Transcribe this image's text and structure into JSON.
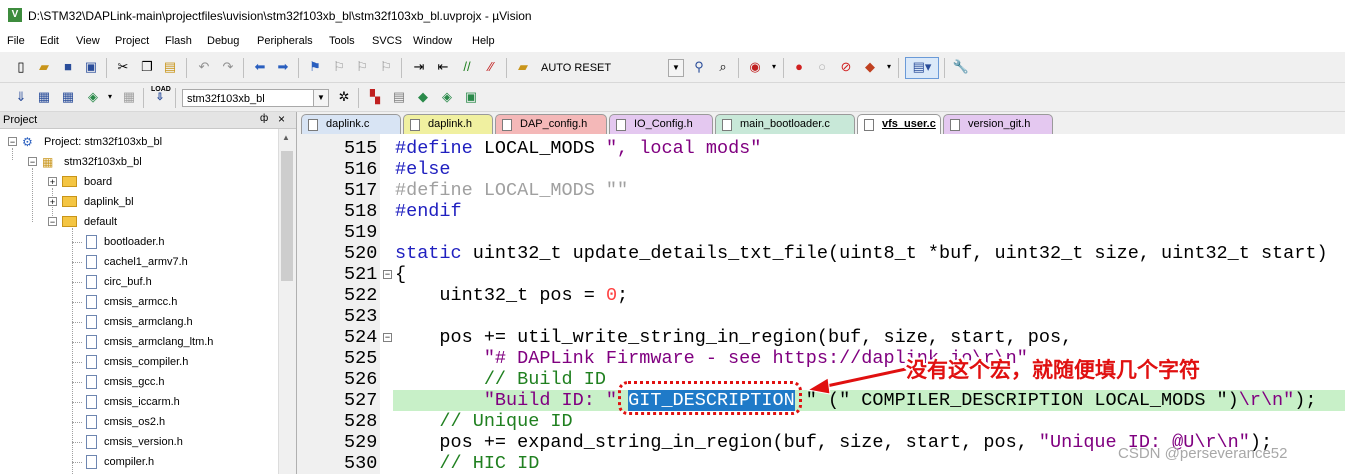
{
  "window": {
    "app_icon_letter": "V",
    "title": "D:\\STM32\\DAPLink-main\\projectfiles\\uvision\\stm32f103xb_bl\\stm32f103xb_bl.uvprojx - µVision"
  },
  "menu": [
    "File",
    "Edit",
    "View",
    "Project",
    "Flash",
    "Debug",
    "Peripherals",
    "Tools",
    "SVCS",
    "Window",
    "Help"
  ],
  "toolbar": {
    "reset_combo": "AUTO RESET",
    "target_combo": "stm32f103xb_bl",
    "load_label": "LOAD"
  },
  "project_panel": {
    "title": "Project",
    "pin": "ф",
    "close": "×",
    "tree": [
      {
        "label": "Project: stm32f103xb_bl",
        "kind": "project"
      },
      {
        "label": "stm32f103xb_bl",
        "kind": "target"
      },
      {
        "label": "board",
        "kind": "folder"
      },
      {
        "label": "daplink_bl",
        "kind": "folder"
      },
      {
        "label": "default",
        "kind": "folder"
      },
      {
        "label": "bootloader.h",
        "kind": "file"
      },
      {
        "label": "cachel1_armv7.h",
        "kind": "file"
      },
      {
        "label": "circ_buf.h",
        "kind": "file"
      },
      {
        "label": "cmsis_armcc.h",
        "kind": "file"
      },
      {
        "label": "cmsis_armclang.h",
        "kind": "file"
      },
      {
        "label": "cmsis_armclang_ltm.h",
        "kind": "file"
      },
      {
        "label": "cmsis_compiler.h",
        "kind": "file"
      },
      {
        "label": "cmsis_gcc.h",
        "kind": "file"
      },
      {
        "label": "cmsis_iccarm.h",
        "kind": "file"
      },
      {
        "label": "cmsis_os2.h",
        "kind": "file"
      },
      {
        "label": "cmsis_version.h",
        "kind": "file"
      },
      {
        "label": "compiler.h",
        "kind": "file"
      }
    ]
  },
  "tabs": [
    {
      "label": "daplink.c",
      "color": "#d8e4f4"
    },
    {
      "label": "daplink.h",
      "color": "#f0f0a0"
    },
    {
      "label": "DAP_config.h",
      "color": "#f4b8b8"
    },
    {
      "label": "IO_Config.h",
      "color": "#e4c8f0"
    },
    {
      "label": "main_bootloader.c",
      "color": "#c8e8d8"
    },
    {
      "label": "vfs_user.c",
      "color": "#ffffff",
      "active": true
    },
    {
      "label": "version_git.h",
      "color": "#e4c8f0"
    }
  ],
  "editor": {
    "lines": [
      {
        "n": "515",
        "parts": [
          [
            "pp",
            "#define"
          ],
          [
            "",
            " LOCAL_MODS "
          ],
          [
            "str",
            "\", local mods\""
          ]
        ]
      },
      {
        "n": "516",
        "parts": [
          [
            "pp",
            "#else"
          ]
        ]
      },
      {
        "n": "517",
        "parts": [
          [
            "ppg",
            "#define LOCAL_MODS \"\""
          ]
        ]
      },
      {
        "n": "518",
        "parts": [
          [
            "pp",
            "#endif"
          ]
        ]
      },
      {
        "n": "519",
        "parts": []
      },
      {
        "n": "520",
        "parts": [
          [
            "kw",
            "static"
          ],
          [
            "",
            " uint32_t update_details_txt_file(uint8_t *buf, uint32_t size, uint32_t start)"
          ]
        ]
      },
      {
        "n": "521",
        "parts": [
          [
            "",
            "{"
          ]
        ],
        "fold": true
      },
      {
        "n": "522",
        "parts": [
          [
            "",
            "    uint32_t pos = "
          ],
          [
            "num",
            "0"
          ],
          [
            "",
            ";"
          ]
        ]
      },
      {
        "n": "523",
        "parts": []
      },
      {
        "n": "524",
        "parts": [
          [
            "",
            "    pos += util_write_string_in_region(buf, size, start, pos,"
          ]
        ],
        "fold": true
      },
      {
        "n": "525",
        "parts": [
          [
            "str",
            "        \"# DAPLink Firmware - see https://daplink.io\\r\\n\""
          ]
        ]
      },
      {
        "n": "526",
        "parts": [
          [
            "cmt",
            "        // Build ID"
          ]
        ]
      },
      {
        "n": "527",
        "parts": [
          [
            "str",
            "        \"Build ID: \" "
          ],
          [
            "sel",
            "GIT_DESCRIPTION"
          ],
          [
            "",
            " \" (\" COMPILER_DESCRIPTION LOCAL_MODS \")"
          ],
          [
            "str",
            "\\r\\n\""
          ],
          [
            "",
            ");"
          ]
        ],
        "highlight": true
      },
      {
        "n": "528",
        "parts": [
          [
            "cmt",
            "    // Unique ID"
          ]
        ]
      },
      {
        "n": "529",
        "parts": [
          [
            "",
            "    pos += expand_string_in_region(buf, size, start, pos, "
          ],
          [
            "str",
            "\"Unique ID: @U\\r\\n\""
          ],
          [
            "",
            ");"
          ]
        ]
      },
      {
        "n": "530",
        "parts": [
          [
            "cmt",
            "    // HIC ID"
          ]
        ]
      }
    ]
  },
  "annotation": {
    "text": "没有这个宏，就随便填几个字符",
    "color": "#e01010"
  },
  "watermark": "CSDN @perseverance52"
}
